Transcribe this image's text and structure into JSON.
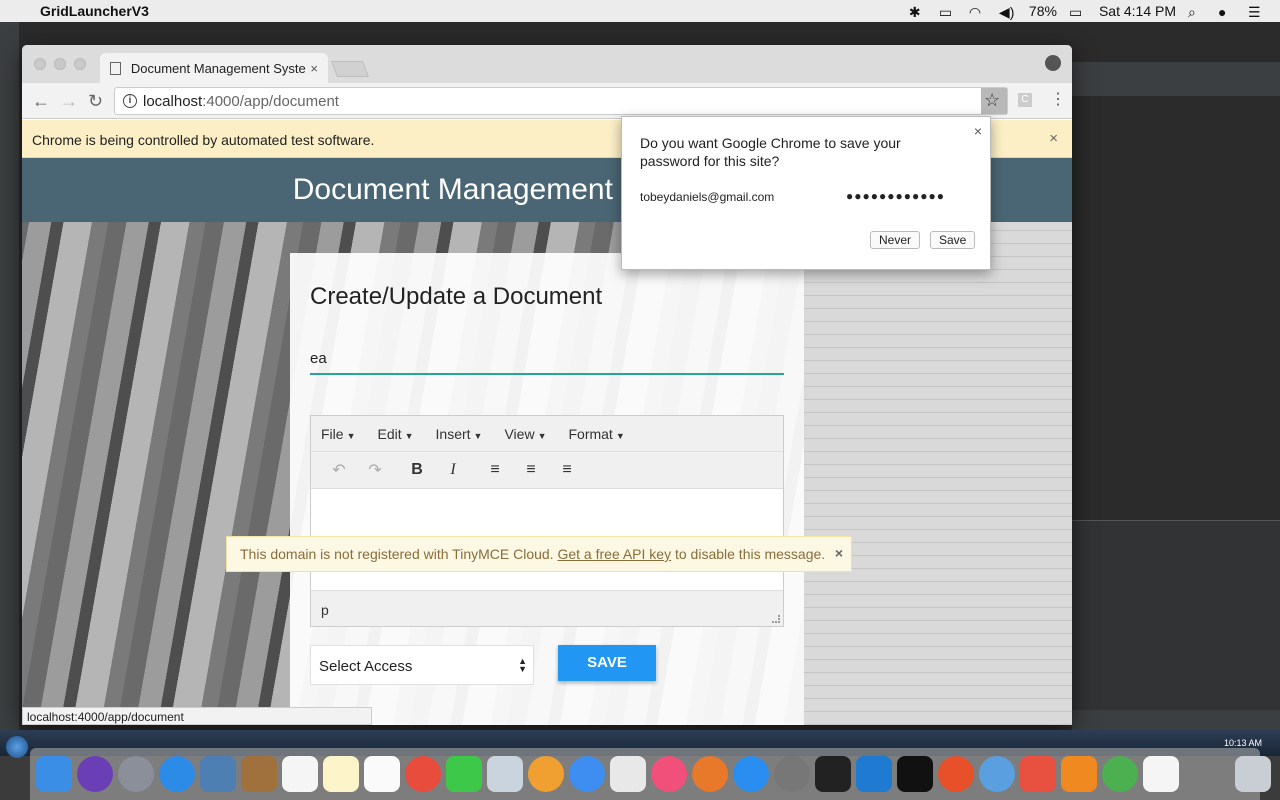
{
  "menubar": {
    "app_name": "GridLauncherV3",
    "battery": "78%",
    "clock": "Sat 4:14 PM"
  },
  "browser": {
    "tab_title": "Document Management Syster",
    "tab_close": "×",
    "url_host": "localhost",
    "url_path": ":4000/app/document",
    "ext_label": "C",
    "infobar_text": "Chrome is being controlled by automated test software.",
    "infobar_close": "×",
    "status_url": "localhost:4000/app/document"
  },
  "password_popup": {
    "question": "Do you want Google Chrome to save your password for this site?",
    "username": "tobeydaniels@gmail.com",
    "password_mask": "●●●●●●●●●●●●",
    "never_label": "Never",
    "save_label": "Save",
    "close": "×"
  },
  "page": {
    "header_title": "Document Management System",
    "card_title": "Create/Update a Document",
    "title_value": "ea",
    "editor": {
      "menus": [
        "File",
        "Edit",
        "Insert",
        "View",
        "Format"
      ],
      "status_path": "p"
    },
    "tinymce_notice": {
      "before": "This domain is not registered with TinyMCE Cloud. ",
      "link": "Get a free API key",
      "after": " to disable this message.",
      "close": "×"
    },
    "select_access_label": "Select Access",
    "save_button": "SAVE"
  },
  "vm_clock": "10:13 AM"
}
